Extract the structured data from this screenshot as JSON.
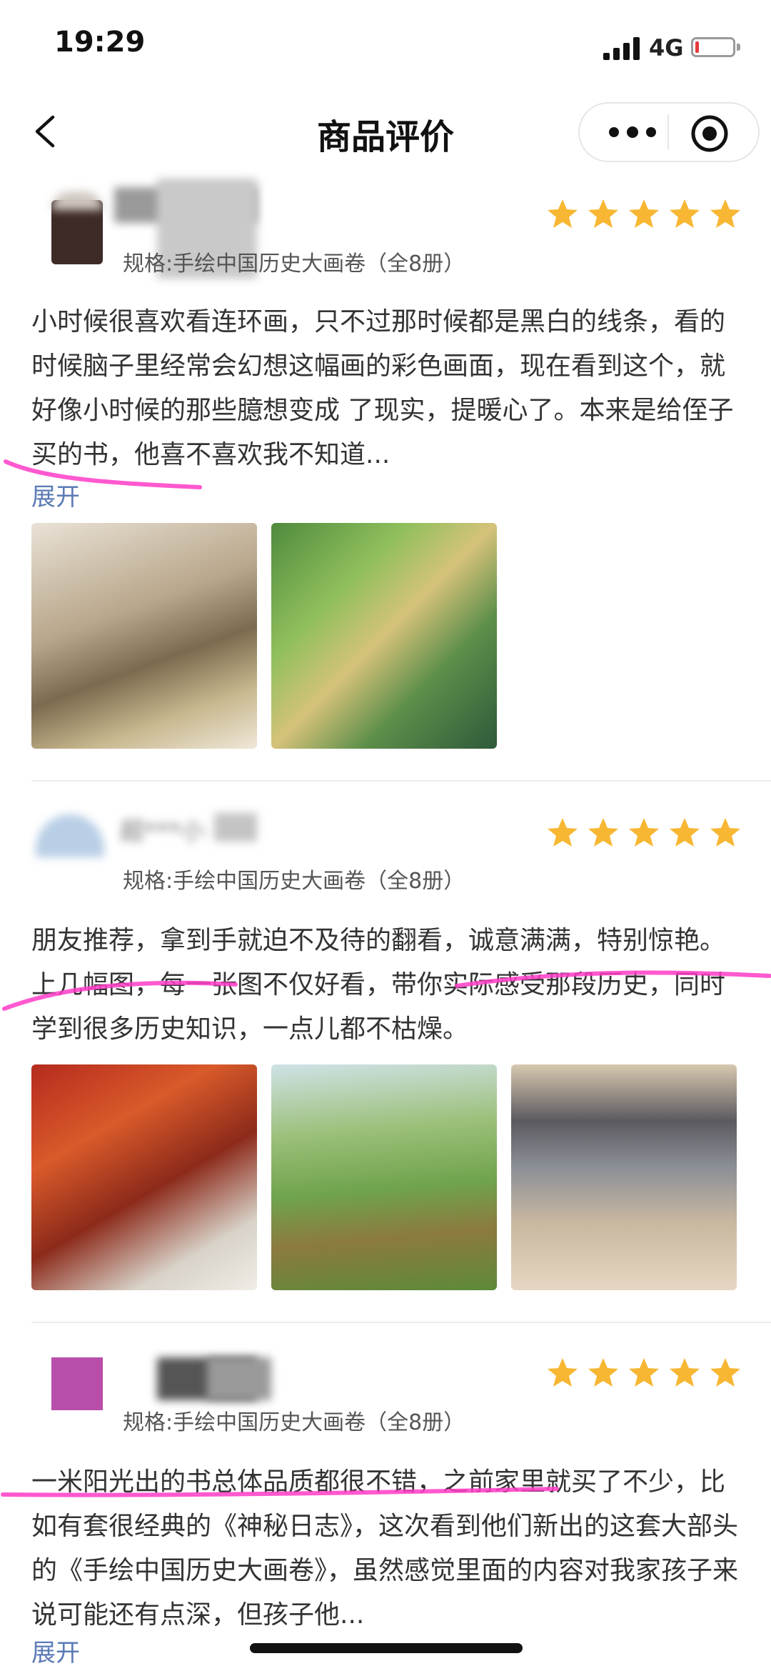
{
  "status_bar": {
    "time": "19:29",
    "network": "4G",
    "battery_color": "#e63b3b"
  },
  "nav": {
    "title": "商品评价",
    "back_icon": "chevron-left-icon",
    "more_icon": "more-dots-icon",
    "target_icon": "record-target-icon"
  },
  "colors": {
    "star": "#f7b733",
    "link": "#5b7bb5",
    "highlight": "#ff3cc8"
  },
  "reviews": [
    {
      "rating": 5,
      "spec": "规格:手绘中国历史大画卷（全8册）",
      "text": "小时候很喜欢看连环画，只不过那时候都是黑白的线条，看的时候脑子里经常会幻想这幅画的彩色画面，现在看到这个，就好像小时候的那些臆想变成 了现实，提暖心了。本来是给侄子买的书，他喜不喜欢我不知道...",
      "expand": "展开",
      "photo_count": 2
    },
    {
      "user": "超***小",
      "rating": 5,
      "spec": "规格:手绘中国历史大画卷（全8册）",
      "text": "朋友推荐，拿到手就迫不及待的翻看，诚意满满，特别惊艳。上几幅图，每一张图不仅好看，带你实际感受那段历史，同时学到很多历史知识，一点儿都不枯燥。",
      "photo_count": 3
    },
    {
      "rating": 5,
      "spec": "规格:手绘中国历史大画卷（全8册）",
      "text": "一米阳光出的书总体品质都很不错，之前家里就买了不少，比如有套很经典的《神秘日志》，这次看到他们新出的这套大部头的《手绘中国历史大画卷》，虽然感觉里面的内容对我家孩子来说可能还有点深，但孩子他...",
      "expand": "展开"
    }
  ]
}
